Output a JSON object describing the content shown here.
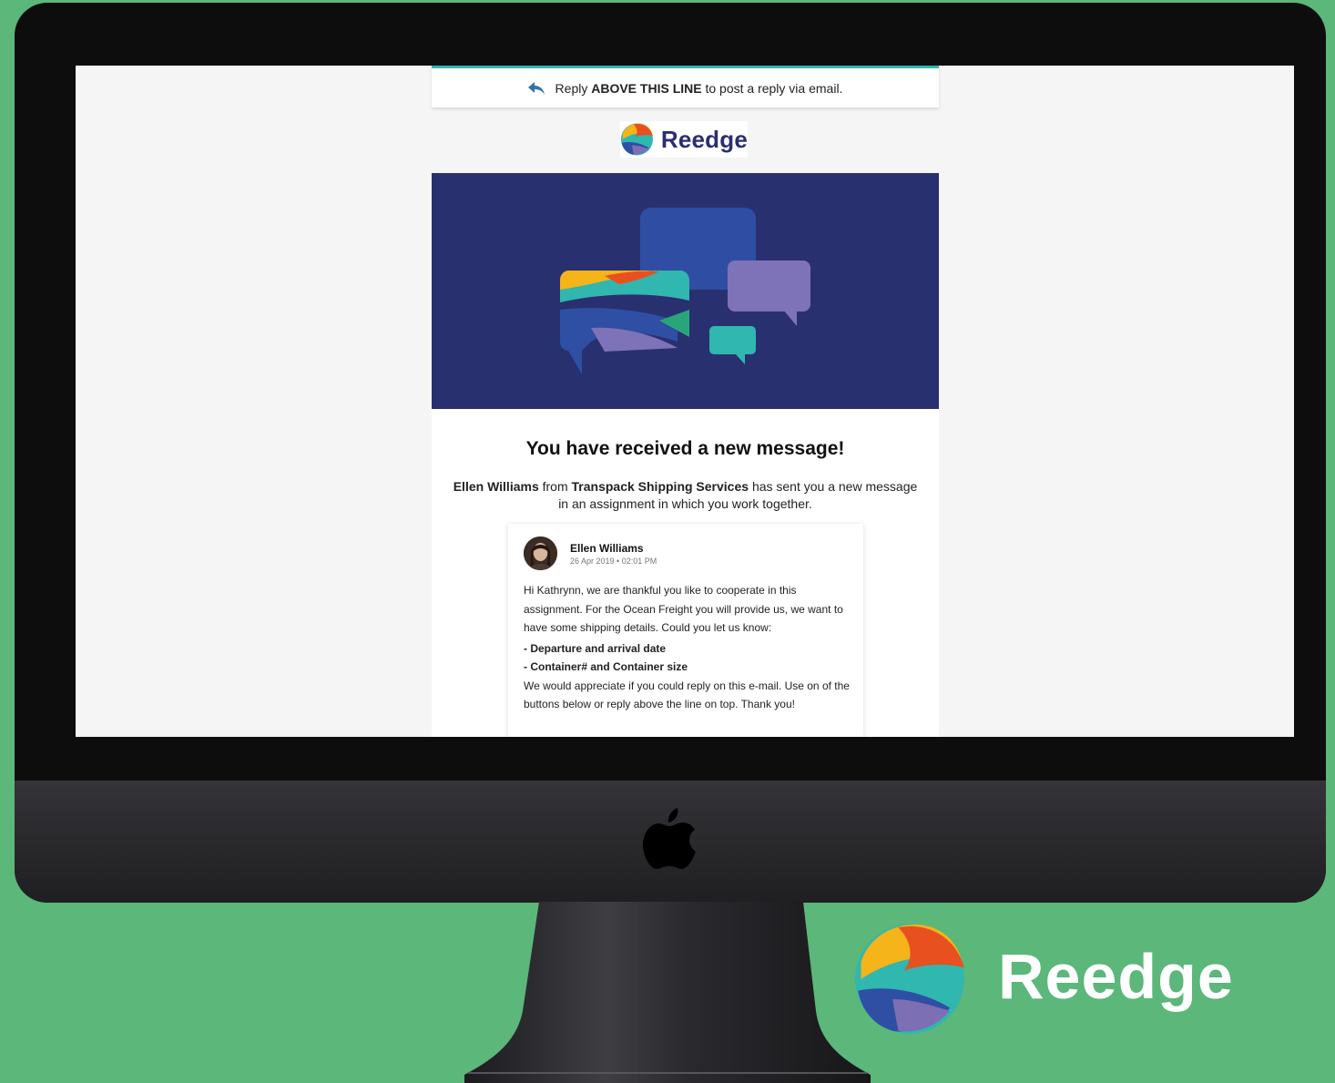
{
  "email": {
    "reply_bar": {
      "prefix": "Reply",
      "emphasis": "ABOVE THIS LINE",
      "suffix": "to post a reply via email."
    },
    "brand_name": "Reedge",
    "headline": "You have received a new message!",
    "intro": {
      "sender": "Ellen Williams",
      "from_word": "from",
      "company": "Transpack Shipping Services",
      "rest": "has sent you a new message in an assignment in which you work together."
    },
    "message": {
      "sender": "Ellen Williams",
      "timestamp": "26 Apr 2019 • 02:01 PM",
      "paragraph1": "Hi Kathrynn, we are thankful you like to cooperate in this assignment. For the Ocean Freight you will provide us, we want to have some shipping details. Could you let us know:",
      "bullets": [
        "- Departure and arrival date",
        "- Container# and Container size"
      ],
      "paragraph2": "We would appreciate if you could reply on this e-mail. Use on of the buttons below or reply above the line on top. Thank you!"
    }
  },
  "brand_corner": {
    "wordmark": "Reedge"
  },
  "colors": {
    "background": "#5bb77a",
    "hero": "#29306f",
    "accent_teal": "#2fb7b0",
    "brand_navy": "#2b2e72",
    "logo_orange": "#e8501f",
    "logo_yellow": "#f4b41a",
    "logo_blue": "#2e4fa3",
    "logo_purple": "#7d6fb4"
  }
}
